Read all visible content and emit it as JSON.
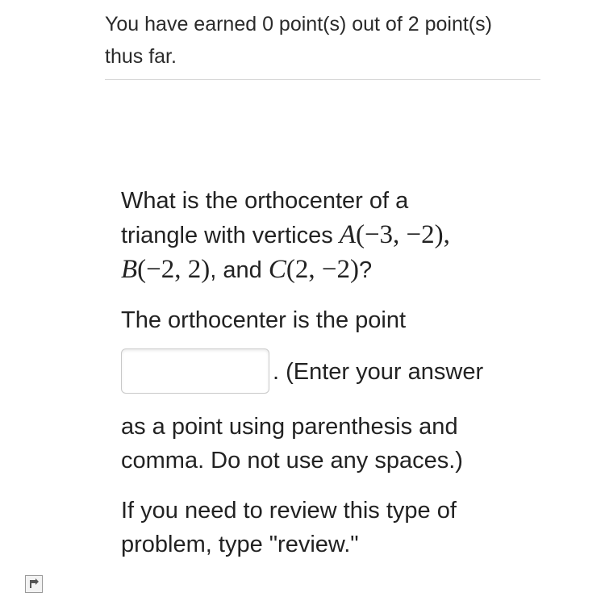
{
  "score": {
    "line1": "You have earned 0 point(s) out of 2 point(s)",
    "line2": "thus far."
  },
  "question": {
    "line1": "What is the orthocenter of a",
    "line2_text": "triangle with vertices ",
    "vertexA_label": "A",
    "vertexA_coords": "(−3, −2),",
    "vertexB_label": "B",
    "vertexB_coords": "(−2, 2)",
    "and_text": ", and ",
    "vertexC_label": "C",
    "vertexC_coords": "(2, −2)",
    "question_mark": "?"
  },
  "answer": {
    "prompt": "The orthocenter is the point",
    "value": "",
    "after_input": ". (Enter your answer",
    "instructions_line1": "as a point using parenthesis and",
    "instructions_line2": "comma. Do not use any spaces.)"
  },
  "review": {
    "line1": "If you need to review this type of",
    "line2": "problem, type \"review.\""
  },
  "icons": {
    "corner": "expand-arrow-icon"
  }
}
